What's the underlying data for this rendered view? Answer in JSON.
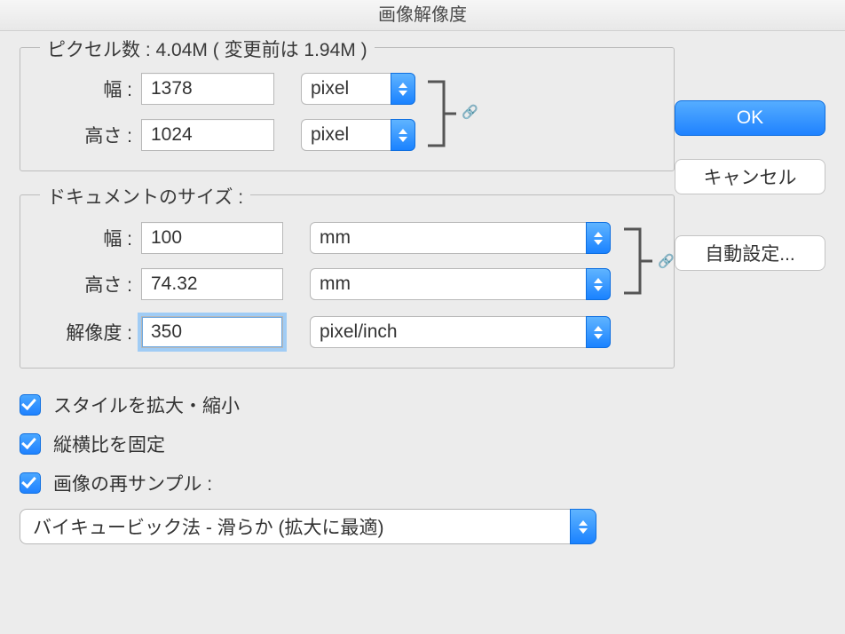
{
  "window_title": "画像解像度",
  "pixel_group": {
    "legend_prefix": "ピクセル数",
    "legend_value": "4.04M",
    "legend_before_label": "変更前は",
    "legend_before_value": "1.94M",
    "width_label": "幅 :",
    "width_value": "1378",
    "width_unit": "pixel",
    "height_label": "高さ :",
    "height_value": "1024",
    "height_unit": "pixel"
  },
  "doc_group": {
    "legend": "ドキュメントのサイズ :",
    "width_label": "幅 :",
    "width_value": "100",
    "width_unit": "mm",
    "height_label": "高さ :",
    "height_value": "74.32",
    "height_unit": "mm",
    "res_label": "解像度 :",
    "res_value": "350",
    "res_unit": "pixel/inch"
  },
  "checkboxes": {
    "scale_styles": "スタイルを拡大・縮小",
    "constrain": "縦横比を固定",
    "resample": "画像の再サンプル :"
  },
  "resample_method": "バイキュービック法 - 滑らか (拡大に最適)",
  "buttons": {
    "ok": "OK",
    "cancel": "キャンセル",
    "auto": "自動設定..."
  }
}
